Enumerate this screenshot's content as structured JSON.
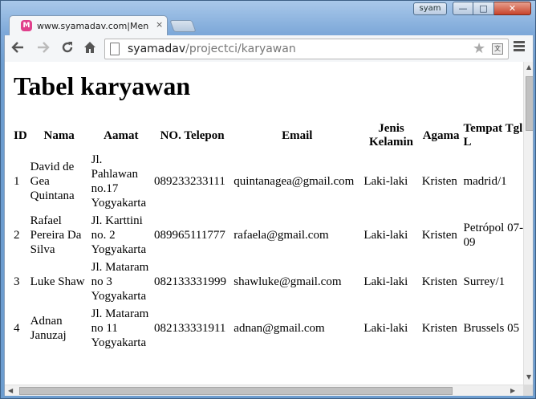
{
  "window": {
    "user_badge": "syam",
    "min_glyph": "—",
    "max_glyph": "□",
    "close_glyph": "✕"
  },
  "tab": {
    "title": "www.syamadav.com|Mena",
    "close": "×",
    "favicon": "M"
  },
  "toolbar": {
    "back_icon": "arrow-left-icon",
    "forward_icon": "arrow-right-icon",
    "reload_icon": "reload-icon",
    "home_icon": "home-icon",
    "url_host": "syamadav",
    "url_path": "/projectci/karyawan",
    "star_icon": "star-icon",
    "menu_icon": "hamburger-menu-icon"
  },
  "page": {
    "heading": "Tabel karyawan",
    "columns": [
      "ID",
      "Nama",
      "Aamat",
      "NO. Telepon",
      "Email",
      "Jenis Kelamin",
      "Agama",
      "Tempat Tgl L"
    ],
    "rows": [
      [
        "1",
        "David de Gea Quintana",
        "Jl. Pahlawan no.17 Yogyakarta",
        "089233233111",
        "quintanagea@gmail.com",
        "Laki-laki",
        "Kristen",
        "madrid/1"
      ],
      [
        "2",
        "Rafael Pereira Da Silva",
        "Jl. Karttini no. 2 Yogyakarta",
        "089965111777",
        "rafaela@gmail.com",
        "Laki-laki",
        "Kristen",
        "Petrópol 07-09"
      ],
      [
        "3",
        "Luke Shaw",
        "Jl. Mataram no 3 Yogyakarta",
        "082133331999",
        "shawluke@gmail.com",
        "Laki-laki",
        "Kristen",
        "Surrey/1"
      ],
      [
        "4",
        "Adnan Januzaj",
        "Jl. Mataram no 11 Yogyakarta",
        "082133331911",
        "adnan@gmail.com",
        "Laki-laki",
        "Kristen",
        "Brussels 05"
      ]
    ]
  },
  "colors": {
    "frame": "#6d9dcf",
    "favicon": "#e0408c",
    "close_button": "#c8432a"
  }
}
